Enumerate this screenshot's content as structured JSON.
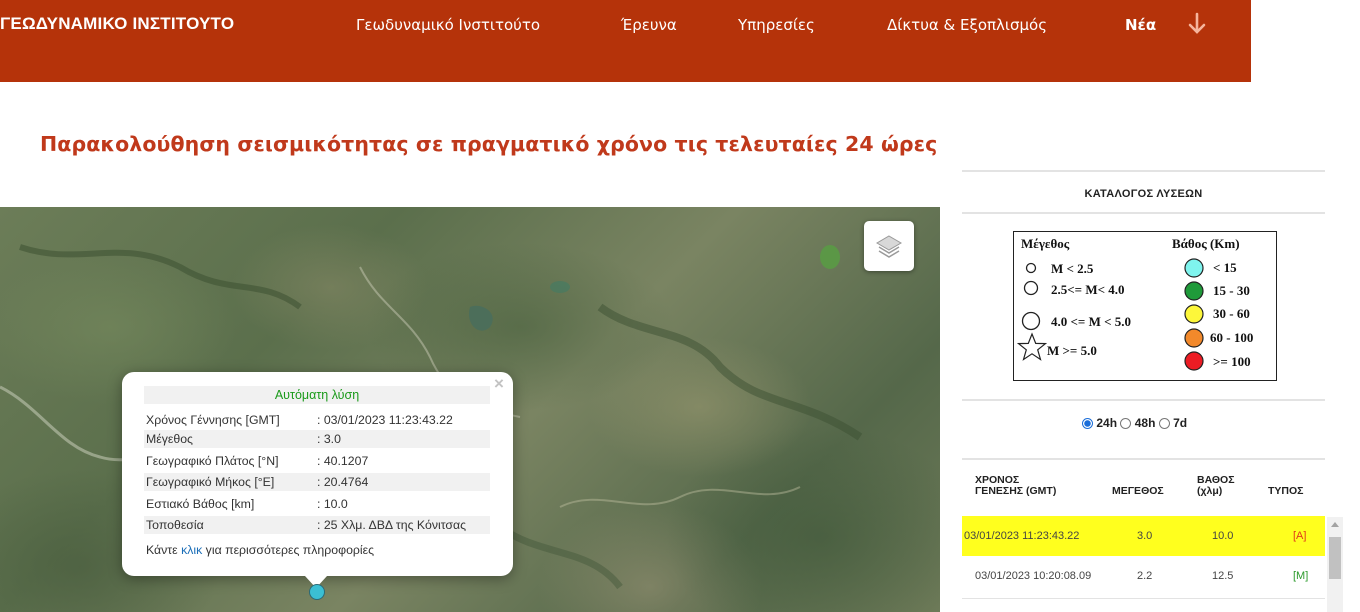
{
  "header": {
    "brand": "ΓΕΩΔΥΝΑΜΙΚΟ ΙΝΣΤΙΤΟΥΤΟ",
    "nav": [
      {
        "label": "Γεωδυναμικό Ινστιτούτο"
      },
      {
        "label": "Έρευνα"
      },
      {
        "label": "Υπηρεσίες"
      },
      {
        "label": "Δίκτυα & Εξοπλισμός"
      },
      {
        "label": "Νέα"
      }
    ],
    "more_icon": "arrow-down-icon"
  },
  "page": {
    "title": "Παρακολούθηση σεισμικότητας σε πραγματικό χρόνο τις τελευταίες 24 ώρες"
  },
  "popup": {
    "heading": "Αυτόματη λύση",
    "close": "×",
    "rows": [
      {
        "label": "Χρόνος Γέννησης [GMT]",
        "value": ": 03/01/2023 11:23:43.22"
      },
      {
        "label": "Μέγεθος",
        "value": ": 3.0"
      },
      {
        "label": "Γεωγραφικό Πλάτος [°N]",
        "value": ": 40.1207"
      },
      {
        "label": "Γεωγραφικό Μήκος [°E]",
        "value": ": 20.4764"
      },
      {
        "label": "Εστιακό Βάθος [km]",
        "value": ": 10.0"
      },
      {
        "label": "Τοποθεσία",
        "value": ": 25 Χλμ. ΔΒΔ της Κόνιτσας"
      }
    ],
    "footer_pre": "Κάντε ",
    "footer_link": "κλικ",
    "footer_post": " για περισσότερες πληροφορίες"
  },
  "panel": {
    "catalog_title": "ΚΑΤΑΛΟΓΟΣ ΛΥΣΕΩΝ",
    "legend": {
      "magnitude_title": "Μέγεθος",
      "magnitude_items": [
        "M < 2.5",
        "2.5<= M< 4.0",
        "4.0 <= M < 5.0",
        "M >= 5.0"
      ],
      "depth_title": "Βάθος (Km)",
      "depth_items": [
        {
          "label": "< 15",
          "color": "#7ff4ee"
        },
        {
          "label": "15 - 30",
          "color": "#1f9a3a"
        },
        {
          "label": "30 - 60",
          "color": "#fdf73a"
        },
        {
          "label": "60 - 100",
          "color": "#f2892b"
        },
        {
          "label": ">= 100",
          "color": "#ec1c24"
        }
      ]
    },
    "periods": [
      {
        "label": "24h",
        "selected": true
      },
      {
        "label": "48h",
        "selected": false
      },
      {
        "label": "7d",
        "selected": false
      }
    ],
    "table": {
      "headers": {
        "time_line1": "ΧΡΟΝΟΣ",
        "time_line2": "ΓΕΝΕΣΗΣ (GMT)",
        "magnitude": "ΜΕΓΕΘΟΣ",
        "depth_line1": "ΒΑΘΟΣ",
        "depth_line2": "(χλμ)",
        "type": "ΤΥΠΟΣ"
      },
      "rows": [
        {
          "time": "03/01/2023 11:23:43.22",
          "magnitude": "3.0",
          "depth": "10.0",
          "type": "[A]",
          "type_color": "#e03a1a"
        },
        {
          "time": "03/01/2023 10:20:08.09",
          "magnitude": "2.2",
          "depth": "12.5",
          "type": "[M]",
          "type_color": "#2a9a2a"
        }
      ]
    }
  },
  "colors": {
    "header_bg": "#b5330a",
    "title": "#c0391b",
    "highlight_row": "#ffff1e",
    "marker": "#3bbfd3"
  }
}
